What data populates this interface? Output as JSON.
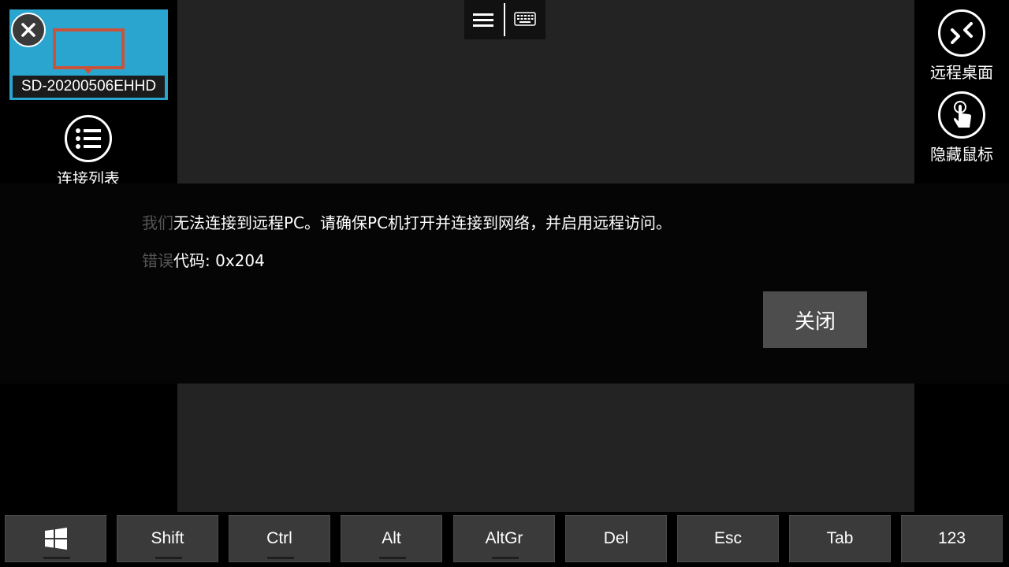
{
  "session": {
    "name": "SD-20200506EHHD"
  },
  "left": {
    "connection_list_label": "连接列表"
  },
  "right": {
    "remote_desktop_label": "远程桌面",
    "hide_mouse_label": "隐藏鼠标"
  },
  "toolbar": {
    "menu_icon": "hamburger-icon",
    "keyboard_icon": "keyboard-icon"
  },
  "dialog": {
    "line1_dim": "我们",
    "line1": "无法连接到远程PC。请确保PC机打开并连接到网络，并启用远程访问。",
    "line2_dim": "错误",
    "line2": "代码: 0x204",
    "close_label": "关闭"
  },
  "keys": [
    {
      "label": "",
      "icon": "windows-icon"
    },
    {
      "label": "Shift"
    },
    {
      "label": "Ctrl"
    },
    {
      "label": "Alt"
    },
    {
      "label": "AltGr"
    },
    {
      "label": "Del"
    },
    {
      "label": "Esc"
    },
    {
      "label": "Tab"
    },
    {
      "label": "123"
    }
  ],
  "colors": {
    "accent": "#29a5cf",
    "monitor": "#c9533b",
    "button": "#4d4d4d"
  }
}
